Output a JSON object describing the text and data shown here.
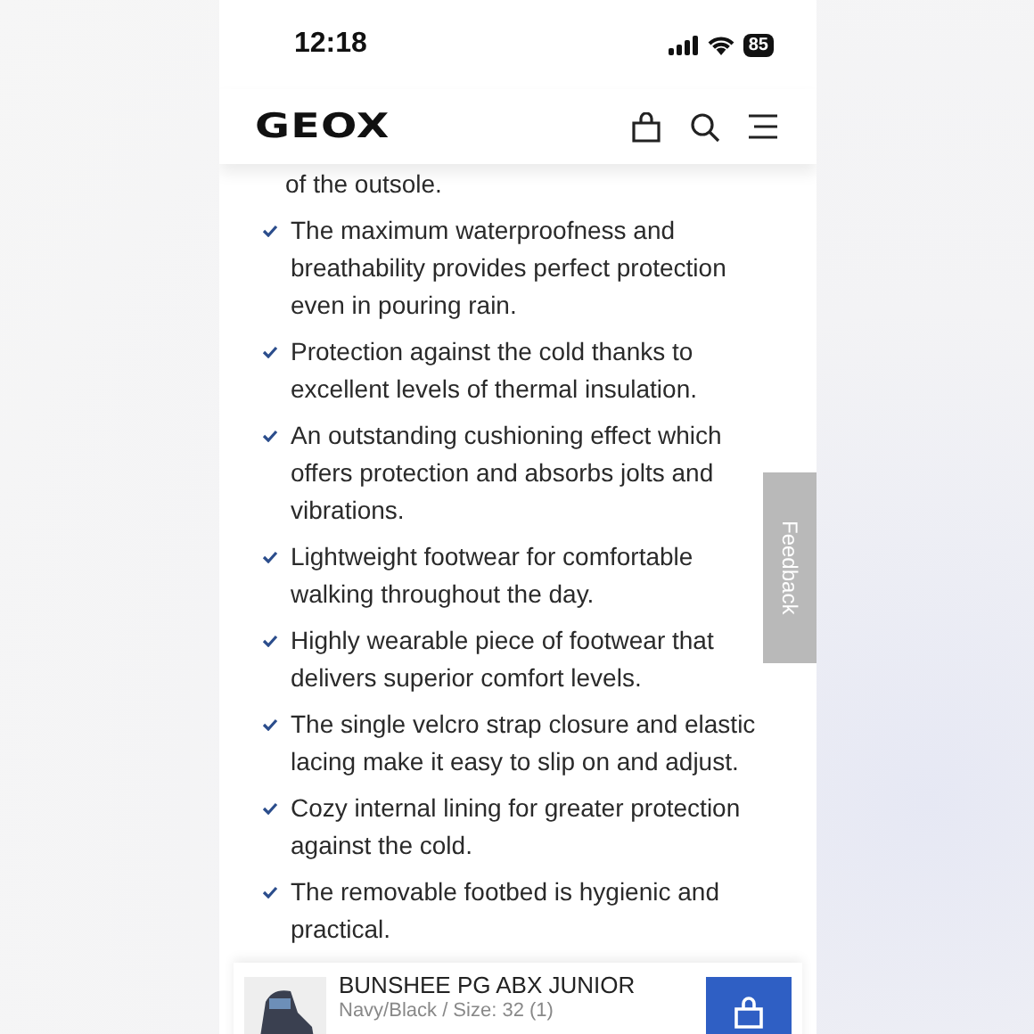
{
  "status_bar": {
    "time": "12:18",
    "battery": "85"
  },
  "header": {
    "logo": "GEOX"
  },
  "lead_text": "of the outsole.",
  "features": [
    "The maximum waterproofness and breathability provides perfect protection even in pouring rain.",
    "Protection against the cold thanks to excellent levels of thermal insulation.",
    "An outstanding cushioning effect which offers protection and absorbs jolts and vibrations.",
    "Lightweight footwear for comfortable walking throughout the day.",
    "Highly wearable piece of footwear that delivers superior comfort levels.",
    "The single velcro strap closure and elastic lacing make it easy to slip on and adjust.",
    "Cozy internal lining for greater protection against the cold.",
    "The removable footbed is hygienic and practical."
  ],
  "feedback_tab": "Feedback",
  "product_bar": {
    "name": "BUNSHEE PG ABX JUNIOR",
    "variant": "Navy/Black / Size: 32 (1)"
  }
}
